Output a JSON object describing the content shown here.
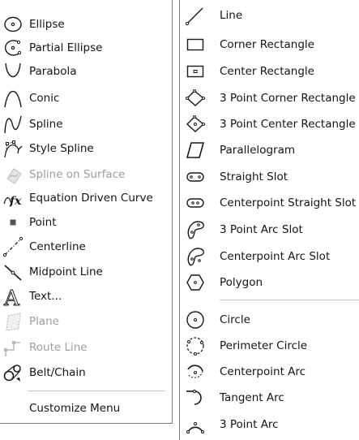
{
  "left_menu": {
    "items": [
      {
        "label": "Ellipse",
        "icon": "ellipse-icon",
        "enabled": true
      },
      {
        "label": "Partial Ellipse",
        "icon": "partial-ellipse-icon",
        "enabled": true
      },
      {
        "label": "Parabola",
        "icon": "parabola-icon",
        "enabled": true
      },
      {
        "label": "Conic",
        "icon": "conic-icon",
        "enabled": true
      },
      {
        "label": "Spline",
        "icon": "spline-icon",
        "enabled": true
      },
      {
        "label": "Style Spline",
        "icon": "style-spline-icon",
        "enabled": true
      },
      {
        "label": "Spline on Surface",
        "icon": "spline-on-surface-icon",
        "enabled": false
      },
      {
        "label": "Equation Driven Curve",
        "icon": "equation-driven-curve-icon",
        "enabled": true
      },
      {
        "label": "Point",
        "icon": "point-icon",
        "enabled": true
      },
      {
        "label": "Centerline",
        "icon": "centerline-icon",
        "enabled": true
      },
      {
        "label": "Midpoint Line",
        "icon": "midpoint-line-icon",
        "enabled": true
      },
      {
        "label": "Text...",
        "icon": "text-icon",
        "enabled": true
      },
      {
        "label": "Plane",
        "icon": "plane-icon",
        "enabled": false
      },
      {
        "label": "Route Line",
        "icon": "route-line-icon",
        "enabled": false
      },
      {
        "label": "Belt/Chain",
        "icon": "belt-chain-icon",
        "enabled": true
      }
    ],
    "customize_label": "Customize Menu"
  },
  "right_menu": {
    "items": [
      {
        "label": "Line",
        "icon": "line-icon"
      },
      {
        "label": "Corner Rectangle",
        "icon": "corner-rectangle-icon"
      },
      {
        "label": "Center Rectangle",
        "icon": "center-rectangle-icon"
      },
      {
        "label": "3 Point Corner Rectangle",
        "icon": "3-point-corner-rectangle-icon"
      },
      {
        "label": "3 Point Center Rectangle",
        "icon": "3-point-center-rectangle-icon"
      },
      {
        "label": "Parallelogram",
        "icon": "parallelogram-icon"
      },
      {
        "label": "Straight Slot",
        "icon": "straight-slot-icon"
      },
      {
        "label": "Centerpoint Straight Slot",
        "icon": "centerpoint-straight-slot-icon"
      },
      {
        "label": "3 Point Arc Slot",
        "icon": "3-point-arc-slot-icon"
      },
      {
        "label": "Centerpoint Arc Slot",
        "icon": "centerpoint-arc-slot-icon"
      },
      {
        "label": "Polygon",
        "icon": "polygon-icon"
      },
      {
        "label": "Circle",
        "icon": "circle-icon"
      },
      {
        "label": "Perimeter Circle",
        "icon": "perimeter-circle-icon"
      },
      {
        "label": "Centerpoint Arc",
        "icon": "centerpoint-arc-icon"
      },
      {
        "label": "Tangent Arc",
        "icon": "tangent-arc-icon"
      },
      {
        "label": "3 Point Arc",
        "icon": "3-point-arc-icon"
      }
    ]
  },
  "colors": {
    "text": "#141414",
    "disabled_text": "#9d9d9d",
    "separator": "#c8c8c8",
    "border": "#7a7a7a",
    "icon_stroke": "#1a1a1a",
    "disabled_icon": "#b9b9b9"
  }
}
